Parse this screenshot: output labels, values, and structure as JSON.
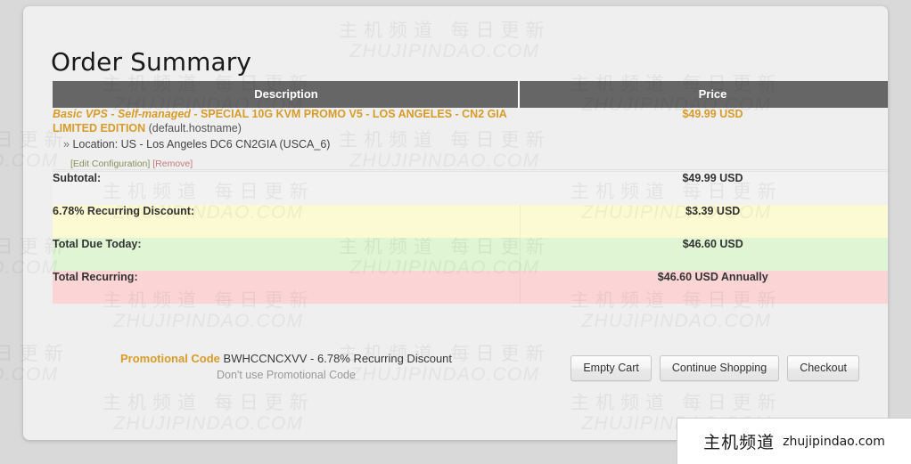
{
  "page": {
    "title": "Order Summary",
    "background_color": "#d9d9d9",
    "card_color": "#efefef"
  },
  "table": {
    "headers": {
      "description": "Description",
      "price": "Price"
    },
    "header_bg": "#666666",
    "product": {
      "name_italic": "Basic VPS - Self-managed",
      "name_rest": " - SPECIAL 10G KVM PROMO V5 - LOS ANGELES - CN2 GIA LIMITED EDITION",
      "hostname": " (default.hostname)",
      "location_prefix": "» ",
      "location": "Location: US - Los Angeles DC6 CN2GIA (USCA_6)",
      "edit_link": "[Edit Configuration]",
      "remove_link": "[Remove]",
      "price": "$49.99 USD",
      "accent_color": "#d79b2a"
    },
    "summary_rows": [
      {
        "label": "Subtotal:",
        "value": "$49.99 USD",
        "bg": "#f2f2f2"
      },
      {
        "label": "6.78% Recurring Discount:",
        "value": "$3.39 USD",
        "bg": "#fcfad2"
      },
      {
        "label": "Total Due Today:",
        "value": "$46.60 USD",
        "bg": "#dff5d3"
      },
      {
        "label": "Total Recurring:",
        "value": "$46.60 USD Annually",
        "bg": "#fbd5d5"
      }
    ]
  },
  "promo": {
    "label": "Promotional Code",
    "code_and_discount": "BWHCCNCXVV - 6.78% Recurring Discount",
    "dont_use_link": "Don't use Promotional Code"
  },
  "buttons": {
    "empty_cart": "Empty Cart",
    "continue_shopping": "Continue Shopping",
    "checkout": "Checkout"
  },
  "badge": {
    "chinese": "主机频道",
    "domain": "zhujipindao.com"
  },
  "watermark": {
    "chinese": "主机频道 每日更新",
    "english": "ZHUJIPINDAO.COM"
  }
}
